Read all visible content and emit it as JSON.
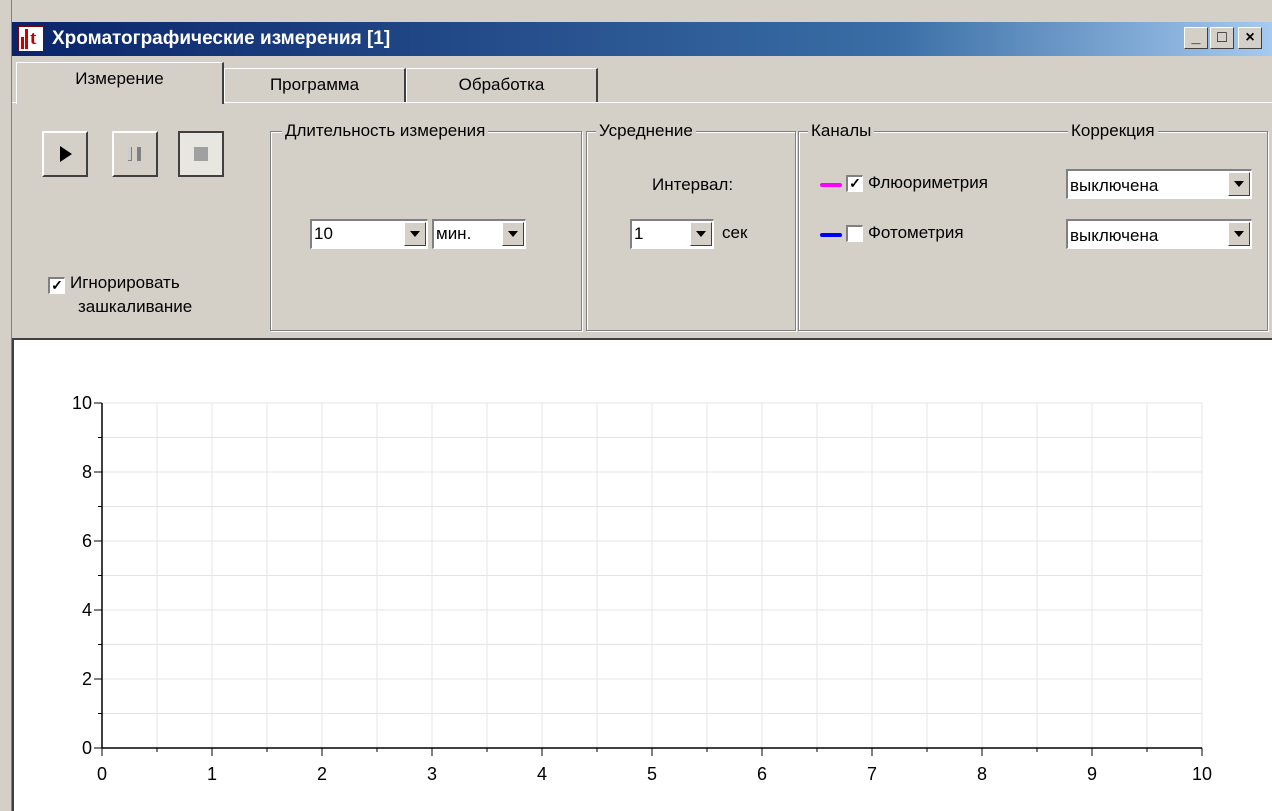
{
  "window": {
    "title": "Хроматографические измерения [1]",
    "controls": {
      "minimize": "_",
      "maximize": "□",
      "close": "×"
    }
  },
  "tabs": [
    {
      "label": "Измерение",
      "active": true
    },
    {
      "label": "Программа",
      "active": false
    },
    {
      "label": "Обработка",
      "active": false
    }
  ],
  "playback": {
    "play_icon": "play-icon",
    "pause_icon": "pause-icon",
    "stop_icon": "stop-icon"
  },
  "ignore_clipping": {
    "label_line1": "Игнорировать",
    "label_line2": "зашкаливание",
    "checked": true
  },
  "duration": {
    "title": "Длительность измерения",
    "value": "10",
    "unit": "мин."
  },
  "averaging": {
    "title": "Усреднение",
    "interval_label": "Интервал:",
    "value": "1",
    "unit": "сек"
  },
  "channels": {
    "title": "Каналы",
    "items": [
      {
        "label": "Флюориметрия",
        "checked": true,
        "color": "#ff00ff"
      },
      {
        "label": "Фотометрия",
        "checked": false,
        "color": "#0000ff"
      }
    ]
  },
  "correction": {
    "title": "Коррекция",
    "values": [
      "выключена",
      "выключена"
    ]
  },
  "chart_data": {
    "type": "line",
    "title": "",
    "xlabel": "",
    "ylabel": "",
    "xlim": [
      0,
      10
    ],
    "ylim": [
      0,
      10
    ],
    "x_ticks": [
      "0",
      "1",
      "2",
      "3",
      "4",
      "5",
      "6",
      "7",
      "8",
      "9",
      "10"
    ],
    "y_ticks": [
      "0",
      "2",
      "4",
      "6",
      "8",
      "10"
    ],
    "grid": true,
    "series": []
  }
}
